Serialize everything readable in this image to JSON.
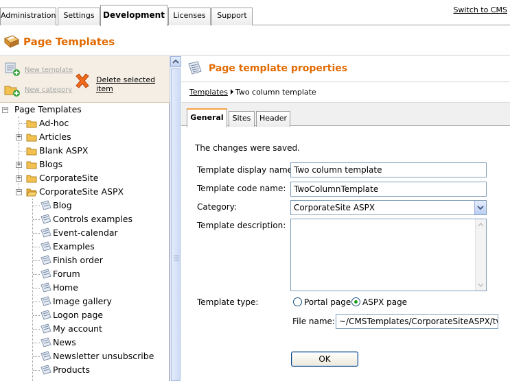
{
  "top_tabs": [
    {
      "label": "Administration"
    },
    {
      "label": "Settings"
    },
    {
      "label": "Development"
    },
    {
      "label": "Licenses"
    },
    {
      "label": "Support"
    }
  ],
  "switch_link": "Switch to CMS",
  "page_title": "Page Templates",
  "left_toolbar": {
    "new_template": "New template",
    "new_category": "New category",
    "delete_selected": "Delete selected item"
  },
  "tree": {
    "root": "Page Templates",
    "items": [
      {
        "label": "Ad-hoc"
      },
      {
        "label": "Articles"
      },
      {
        "label": "Blank ASPX"
      },
      {
        "label": "Blogs"
      },
      {
        "label": "CorporateSite"
      },
      {
        "label": "CorporateSite ASPX"
      }
    ],
    "children": [
      {
        "label": "Blog"
      },
      {
        "label": "Controls examples"
      },
      {
        "label": "Event-calendar"
      },
      {
        "label": "Examples"
      },
      {
        "label": "Finish order"
      },
      {
        "label": "Forum"
      },
      {
        "label": "Home"
      },
      {
        "label": "Image gallery"
      },
      {
        "label": "Logon page"
      },
      {
        "label": "My account"
      },
      {
        "label": "News"
      },
      {
        "label": "Newsletter unsubscribe"
      },
      {
        "label": "Products"
      }
    ]
  },
  "right": {
    "title": "Page template properties",
    "breadcrumb": {
      "link": "Templates",
      "current": "Two column template"
    },
    "tabs": [
      {
        "label": "General"
      },
      {
        "label": "Sites"
      },
      {
        "label": "Header"
      }
    ],
    "message": "The changes were saved.",
    "form": {
      "display_name_label": "Template display name:",
      "display_name_value": "Two column template",
      "code_name_label": "Template code name:",
      "code_name_value": "TwoColumnTemplate",
      "category_label": "Category:",
      "category_value": "CorporateSite ASPX",
      "description_label": "Template description:",
      "type_label": "Template type:",
      "type_options": [
        {
          "label": "Portal page",
          "checked": false
        },
        {
          "label": "ASPX page",
          "checked": true
        }
      ],
      "file_name_label": "File name:",
      "file_name_value": "~/CMSTemplates/CorporateSiteASPX/tv",
      "ok_label": "OK"
    }
  },
  "colors": {
    "accent": "#e26a00",
    "toolbar_bg": "#f4eee4"
  }
}
